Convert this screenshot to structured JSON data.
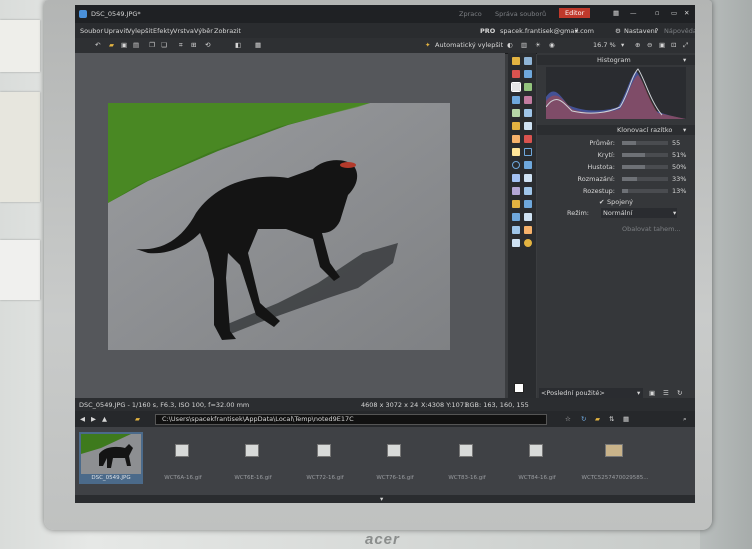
{
  "window": {
    "title": "DSC_0549.JPG*",
    "mode_tabs": [
      "Zpraco",
      "Správa souborů",
      "Editor"
    ],
    "active_mode": "Editor"
  },
  "menu": [
    "Soubor",
    "Upravit",
    "Vylepšit",
    "Efekty",
    "Vrstva",
    "Výběr",
    "Zobrazit"
  ],
  "account": {
    "badge": "PRO",
    "email": "spacek.frantisek@gmail.com",
    "settings": "Nastavení",
    "help": "Nápověda"
  },
  "toolbar": {
    "auto_enhance": "Automatický vylepšit",
    "zoom": "16.7 %"
  },
  "panels": {
    "histogram_title": "Histogram",
    "clone_title": "Klonovací razítko",
    "params": [
      {
        "label": "Průměr:",
        "value": "55",
        "level": 0.3
      },
      {
        "label": "Krytí:",
        "value": "51%",
        "level": 0.51
      },
      {
        "label": "Hustota:",
        "value": "50%",
        "level": 0.5
      },
      {
        "label": "Rozmazání:",
        "value": "33%",
        "level": 0.33
      },
      {
        "label": "Rozestup:",
        "value": "13%",
        "level": 0.13
      }
    ],
    "joined_label": "Spojený",
    "mode_label": "Režim:",
    "mode_value": "Normální",
    "disabled_action": "Obalovat tahem...",
    "recent_used": "<Poslední použité>"
  },
  "status": {
    "file_info": "DSC_0549.JPG - 1/160 s, F6.3, ISO 100, f=32.00 mm",
    "dimensions": "4608 x 3072 x 24",
    "coords": "X:4308 Y:1071",
    "rgb": "RGB: 163, 160, 155"
  },
  "path": "C:\\Users\\spacekfrantisek\\AppData\\Local\\Temp\\noted9E17C",
  "filmstrip": [
    "DSC_0549.JPG",
    "WCT6A-16.gif",
    "WCT6E-16.gif",
    "WCT72-16.gif",
    "WCT76-16.gif",
    "WCT83-16.gif",
    "WCT84-16.gif",
    "WCTC5257470029585..."
  ],
  "brand": "acer",
  "colors": {
    "accent": "#c0392b",
    "grass": "#3e7a1d",
    "asphalt": "#8d8f92",
    "dog": "#141414"
  }
}
